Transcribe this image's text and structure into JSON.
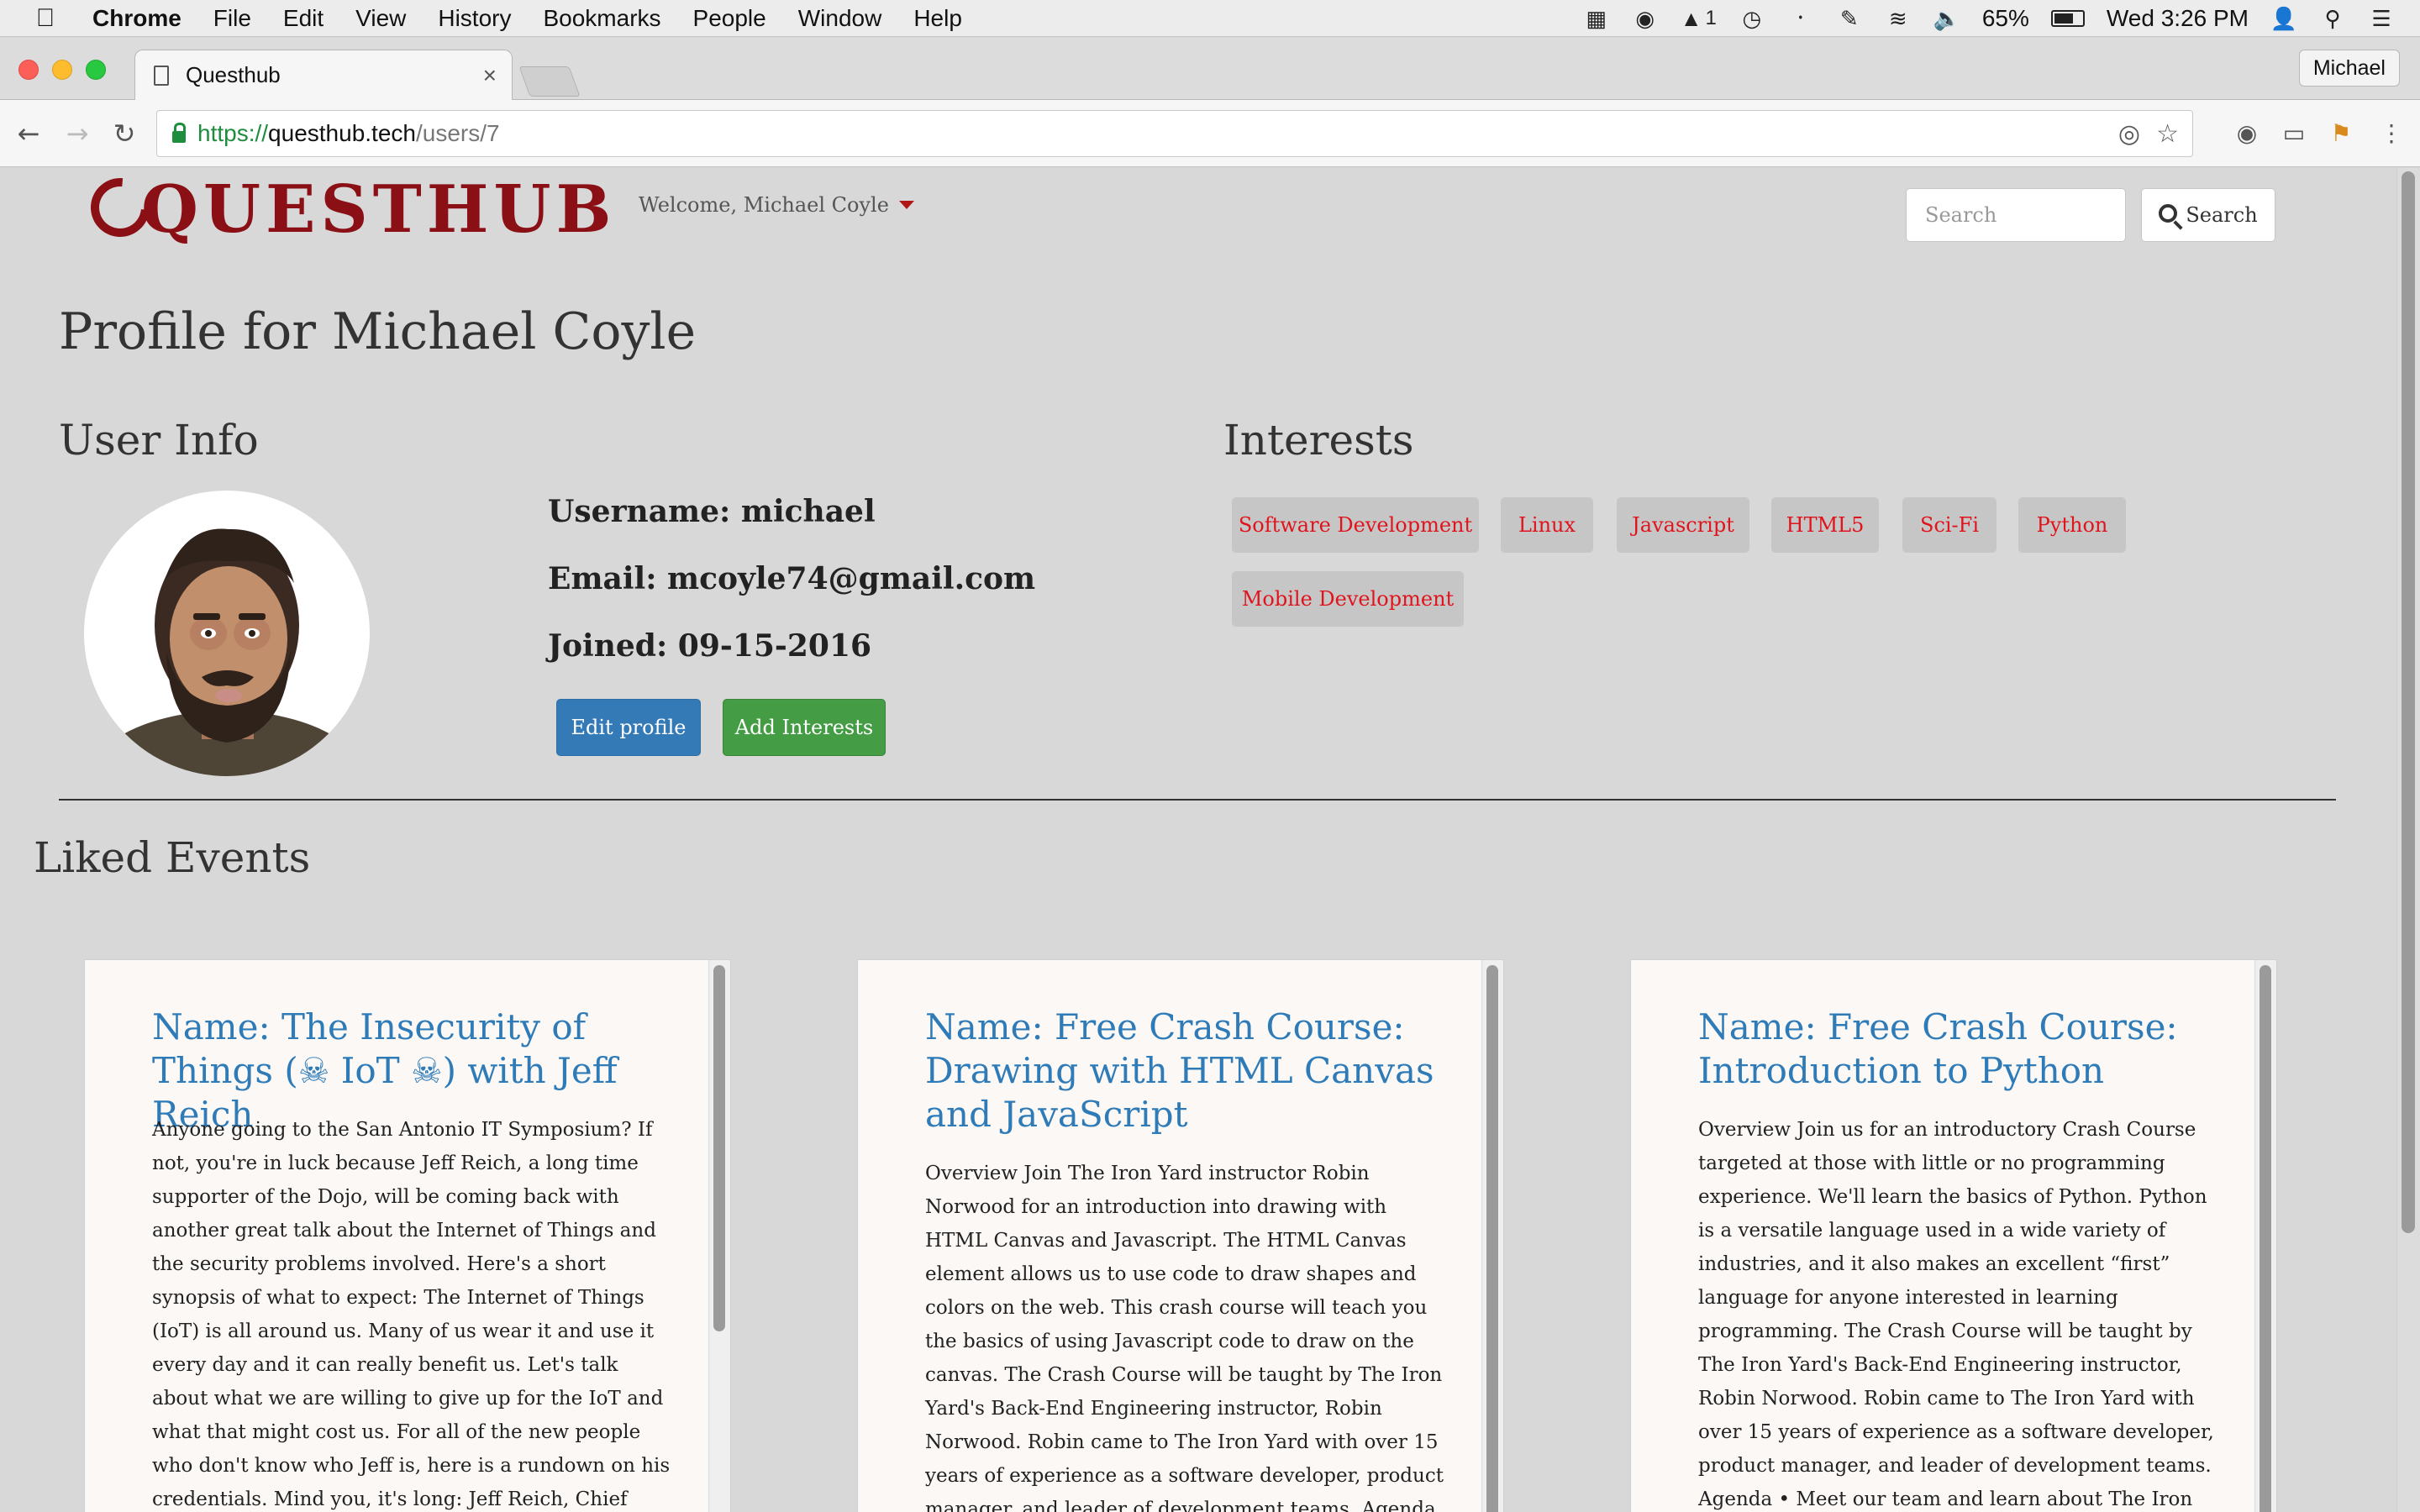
{
  "os_menubar": {
    "apple": "",
    "app_name": "Chrome",
    "items": [
      "File",
      "Edit",
      "View",
      "History",
      "Bookmarks",
      "People",
      "Window",
      "Help"
    ],
    "battery": "65%",
    "clock": "Wed 3:26 PM",
    "badge_count": "1"
  },
  "browser": {
    "tab_title": "Questhub",
    "tab_close": "×",
    "profile_name": "Michael",
    "url_scheme": "https://",
    "url_host": "questhub.tech",
    "url_path": "/users/7"
  },
  "site": {
    "logo_text": "QUESTHUB",
    "welcome_text": "Welcome, Michael Coyle",
    "search_placeholder": "Search",
    "search_button": "Search"
  },
  "profile": {
    "title": "Profile for Michael Coyle",
    "user_info_heading": "User Info",
    "username_line": "Username: michael",
    "email_line": "Email: mcoyle74@gmail.com",
    "joined_line": "Joined: 09-15-2016",
    "edit_button": "Edit profile",
    "add_interests_button": "Add Interests",
    "interests_heading": "Interests",
    "interests": [
      "Software Development",
      "Linux",
      "Javascript",
      "HTML5",
      "Sci-Fi",
      "Python",
      "Mobile Development"
    ]
  },
  "liked": {
    "heading": "Liked Events",
    "events": [
      {
        "title": "Name: The Insecurity of Things (☠ IoT ☠) with Jeff Reich",
        "body": "Anyone going to the San Antonio IT Symposium? If not, you're in luck because Jeff Reich, a long time supporter of the Dojo, will be coming back with another great talk about the Internet of Things and the security problems involved. Here's a short synopsis of what to expect: The Internet of Things (IoT) is all around us. Many of us wear it and use it every day and it can really benefit us. Let's talk about what we are willing to give up for the IoT and what that might cost us. For all of the new people who don't know who Jeff is, here is a rundown on his credentials. Mind you, it's long: Jeff Reich, Chief Security Officer at Barricade Security Systems, has developed a"
      },
      {
        "title": "Name: Free Crash Course: Drawing with HTML Canvas and JavaScript",
        "body": "Overview  Join The Iron Yard instructor Robin Norwood for an introduction into drawing with HTML Canvas and Javascript. The HTML Canvas element allows us to use code to draw shapes and colors on the web. This crash course will teach you the basics of using Javascript code to draw on the canvas. The Crash Course will be taught by The Iron Yard's Back-End Engineering instructor, Robin Norwood. Robin came to The Iron Yard with over 15 years of experience as a software developer, product manager, and leader of development teams. Agenda •  Meet our team and learn about The Iron Yard (TIY)"
      },
      {
        "title": "Name: Free Crash Course: Introduction to Python",
        "body": "Overview  Join us for an introductory Crash Course targeted at those with little or no programming experience. We'll learn the basics of Python. Python is a versatile language used in a wide variety of industries, and it also makes an excellent “first” language for anyone interested in learning programming. The Crash Course will be taught by The Iron Yard's Back-End Engineering instructor, Robin Norwood. Robin came to The Iron Yard with over 15 years of experience as a software developer, product manager, and leader of development teams. Agenda •  Meet our team and learn about The Iron Yard (TIY) •  Learn about Python •"
      }
    ]
  },
  "colors": {
    "brand_red": "#8a1016",
    "tag_text": "#e0141c",
    "link_blue": "#2e7bb8",
    "primary_button": "#337ab7",
    "success_button": "#449d44"
  }
}
